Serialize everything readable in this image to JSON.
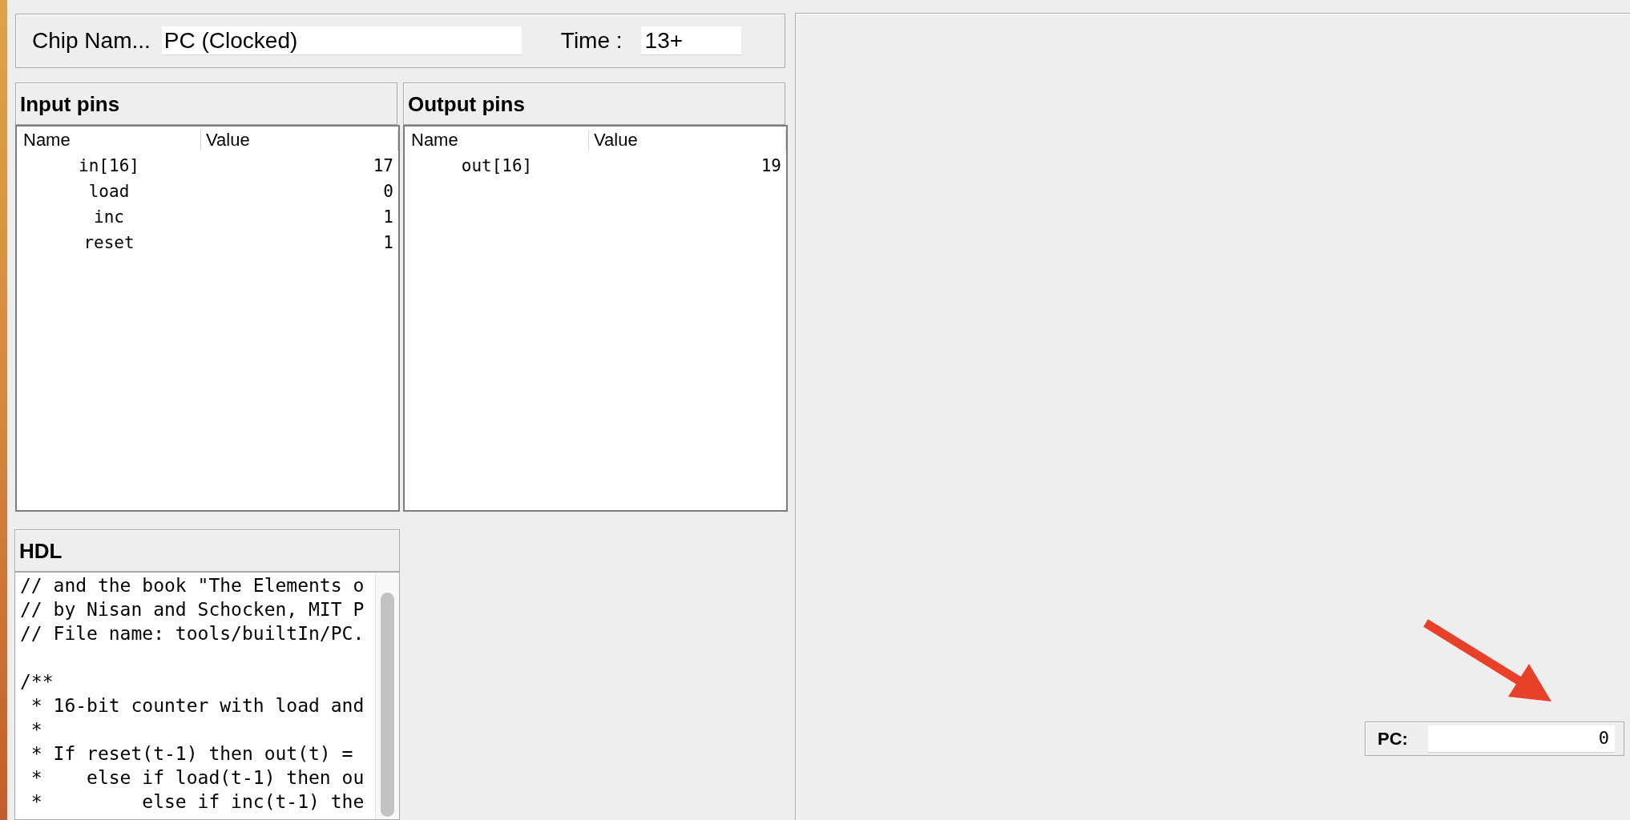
{
  "header": {
    "chip_name_label": "Chip Nam...",
    "chip_name": "PC (Clocked)",
    "time_label": "Time :",
    "time": "13+"
  },
  "input_pins": {
    "title": "Input pins",
    "columns": [
      "Name",
      "Value"
    ],
    "rows": [
      {
        "name": "in[16]",
        "value": "17"
      },
      {
        "name": "load",
        "value": "0"
      },
      {
        "name": "inc",
        "value": "1"
      },
      {
        "name": "reset",
        "value": "1"
      }
    ]
  },
  "output_pins": {
    "title": "Output pins",
    "columns": [
      "Name",
      "Value"
    ],
    "rows": [
      {
        "name": "out[16]",
        "value": "19"
      }
    ]
  },
  "hdl": {
    "title": "HDL",
    "code": "// and the book \"The Elements o\n// by Nisan and Schocken, MIT P\n// File name: tools/builtIn/PC.\n\n/**\n * 16-bit counter with load and\n *\n * If reset(t-1) then out(t) =\n *    else if load(t-1) then ou\n *         else if inc(t-1) the"
  },
  "pc": {
    "label": "PC:",
    "value": "0"
  }
}
